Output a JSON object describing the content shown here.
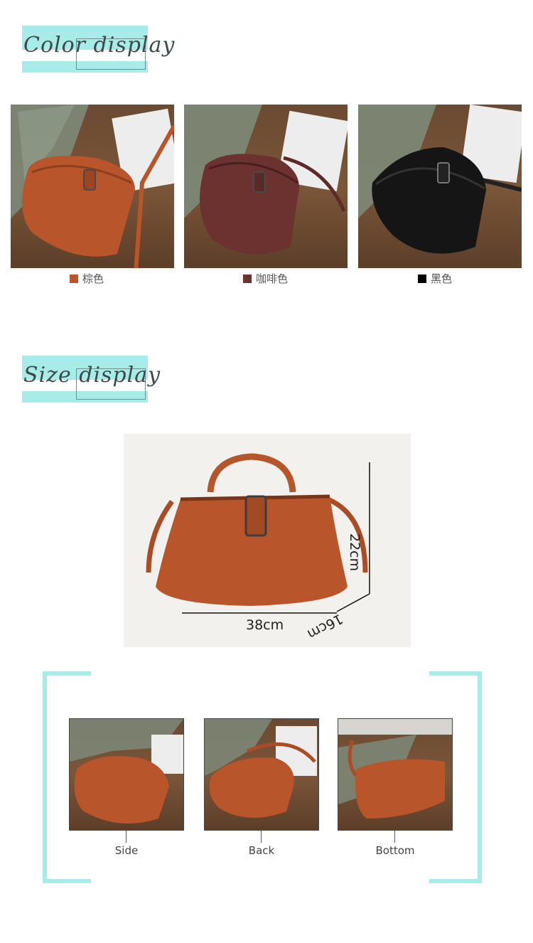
{
  "colors": {
    "accent": "#a7ece8",
    "brown": "#b8552b",
    "coffee": "#6b3230",
    "black": "#000000"
  },
  "color_section": {
    "title": "Color display",
    "items": [
      {
        "label": "棕色",
        "swatch": "#b8552b"
      },
      {
        "label": "咖啡色",
        "swatch": "#6b3230"
      },
      {
        "label": "黑色",
        "swatch": "#000000"
      }
    ]
  },
  "size_section": {
    "title": "Size display",
    "height": "22cm",
    "width": "38cm",
    "depth": "16cm"
  },
  "detail_section": {
    "items": [
      {
        "label": "Side"
      },
      {
        "label": "Back"
      },
      {
        "label": "Bottom"
      }
    ]
  }
}
